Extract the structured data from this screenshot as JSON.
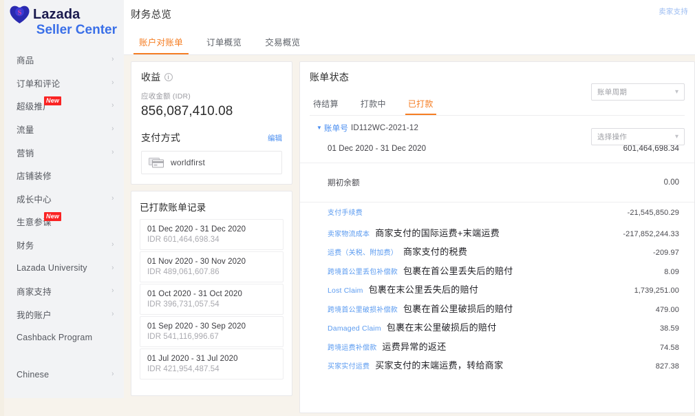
{
  "brand": {
    "name_top": "Lazada",
    "name_bottom": "Seller Center",
    "logo_mark": "lazada-heart-logo",
    "colors": {
      "heart": "#2a2ab0",
      "s_glyph": "#e040a0",
      "name_top": "#1a1a4e",
      "name_bottom": "#3a6fe8"
    }
  },
  "sidebar": {
    "items": [
      {
        "label": "商品",
        "chevron": true,
        "badge": null
      },
      {
        "label": "订单和评论",
        "chevron": true,
        "badge": null
      },
      {
        "label": "超级推广",
        "chevron": true,
        "badge": "New"
      },
      {
        "label": "流量",
        "chevron": true,
        "badge": null
      },
      {
        "label": "营销",
        "chevron": true,
        "badge": null
      },
      {
        "label": "店铺装修",
        "chevron": false,
        "badge": null
      },
      {
        "label": "成长中心",
        "chevron": true,
        "badge": null
      },
      {
        "label": "生意参谋",
        "chevron": false,
        "badge": "New"
      },
      {
        "label": "财务",
        "chevron": true,
        "badge": null
      },
      {
        "label": "Lazada University",
        "chevron": true,
        "badge": null
      },
      {
        "label": "商家支持",
        "chevron": true,
        "badge": null
      },
      {
        "label": "我的账户",
        "chevron": true,
        "badge": null
      },
      {
        "label": "Cashback Program",
        "chevron": false,
        "badge": null
      }
    ],
    "language": {
      "label": "Chinese",
      "chevron": true
    }
  },
  "header": {
    "page_title": "财务总览",
    "seller_support": "卖家支持",
    "tabs": [
      {
        "label": "账户对账单",
        "active": true
      },
      {
        "label": "订单概览",
        "active": false
      },
      {
        "label": "交易概览",
        "active": false
      }
    ],
    "accent_color": "#f57d22"
  },
  "revenue_card": {
    "title": "收益",
    "info_icon": "info-circle-icon",
    "sub_label": "应收金额 (IDR)",
    "amount": "856,087,410.08",
    "payment_method_title": "支付方式",
    "edit_label": "编辑",
    "payment_method_name": "worldfirst",
    "payment_icon": "credit-card-icon"
  },
  "records_card": {
    "title": "已打款账单记录",
    "items": [
      {
        "range": "01 Dec 2020 - 31 Dec 2020",
        "amount": "IDR 601,464,698.34"
      },
      {
        "range": "01 Nov 2020 - 30 Nov 2020",
        "amount": "IDR 489,061,607.86"
      },
      {
        "range": "01 Oct 2020 - 31 Oct 2020",
        "amount": "IDR 396,731,057.54"
      },
      {
        "range": "01 Sep 2020 - 30 Sep 2020",
        "amount": "IDR 541,116,996.67"
      },
      {
        "range": "01 Jul 2020 - 31 Jul 2020",
        "amount": "IDR 421,954,487.54"
      }
    ]
  },
  "bill_panel": {
    "title": "账单状态",
    "period_select": {
      "value": "账单周期",
      "chevron": "chevron-down-icon"
    },
    "action_select": {
      "value": "选择操作",
      "chevron": "chevron-down-icon"
    },
    "sub_tabs": [
      {
        "label": "待结算",
        "active": false
      },
      {
        "label": "打款中",
        "active": false
      },
      {
        "label": "已打款",
        "active": true
      }
    ],
    "bill_number_label": "账单号",
    "bill_number_id": "ID112WC-2021-12",
    "bill_period": "01 Dec 2020 - 31 Dec 2020",
    "bill_period_amount": "601,464,698.34",
    "opening_balance_label": "期初余额",
    "opening_balance_amount": "0.00",
    "lines": [
      {
        "label": "支付手续费",
        "is_en": false,
        "note": "",
        "amount": "-21,545,850.29"
      },
      {
        "label": "卖家物流成本",
        "is_en": false,
        "note": "商家支付的国际运费+末端运费",
        "amount": "-217,852,244.33"
      },
      {
        "label": "运费（关税、附加费）",
        "is_en": false,
        "note": "商家支付的税费",
        "amount": "-209.97"
      },
      {
        "label": "跨境首公里丢包补偿款",
        "is_en": false,
        "note": "包裹在首公里丢失后的赔付",
        "amount": "8.09"
      },
      {
        "label": "Lost Claim",
        "is_en": true,
        "note": "包裹在末公里丢失后的赔付",
        "amount": "1,739,251.00"
      },
      {
        "label": "跨境首公里破损补偿款",
        "is_en": false,
        "note": "包裹在首公里破损后的赔付",
        "amount": "479.00"
      },
      {
        "label": "Damaged Claim",
        "is_en": true,
        "note": "包裹在末公里破损后的赔付",
        "amount": "38.59"
      },
      {
        "label": "跨境运费补偿款",
        "is_en": false,
        "note": "运费异常的返还",
        "amount": "74.58"
      },
      {
        "label": "买家实付运费",
        "is_en": false,
        "note": "买家支付的末端运费，转给商家",
        "amount": "827.38"
      }
    ]
  }
}
